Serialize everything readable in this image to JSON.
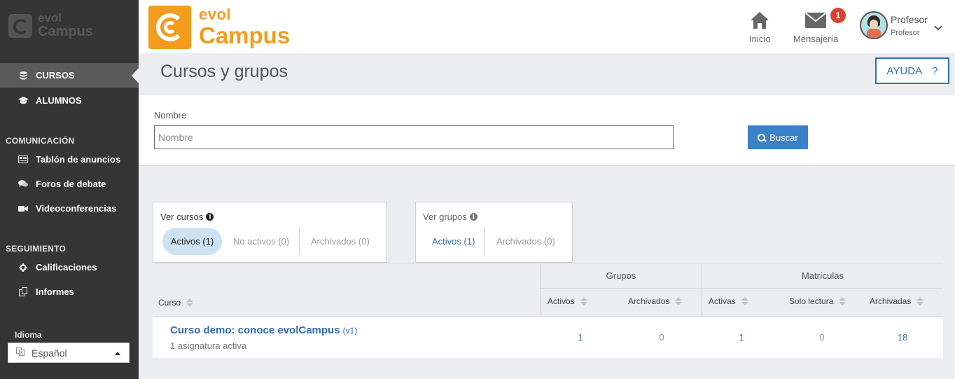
{
  "sidebar": {
    "logo": {
      "top": "evol",
      "bottom": "Campus"
    },
    "items": [
      {
        "label": "CURSOS",
        "icon": "database-icon"
      },
      {
        "label": "ALUMNOS",
        "icon": "graduation-cap-icon"
      }
    ],
    "sections": [
      {
        "title": "COMUNICACIÓN",
        "items": [
          {
            "label": "Tablón de anuncios",
            "icon": "newspaper-icon"
          },
          {
            "label": "Foros de debate",
            "icon": "comments-icon"
          },
          {
            "label": "Videoconferencias",
            "icon": "video-camera-icon"
          }
        ]
      },
      {
        "title": "SEGUIMIENTO",
        "items": [
          {
            "label": "Calificaciones",
            "icon": "gear-icon"
          },
          {
            "label": "Informes",
            "icon": "copy-icon"
          }
        ]
      }
    ],
    "language": {
      "label": "Idioma",
      "selected": "Español"
    }
  },
  "topbar": {
    "brand": {
      "top": "evol",
      "bottom": "Campus"
    },
    "home_label": "Inicio",
    "messages_label": "Mensajería",
    "messages_badge": "1",
    "user": {
      "name": "Profesor",
      "role": "Profesor"
    }
  },
  "page": {
    "title": "Cursos y grupos",
    "help_label": "AYUDA",
    "help_icon": "?"
  },
  "filter": {
    "name_label": "Nombre",
    "name_placeholder": "Nombre",
    "name_value": "",
    "search_label": "Buscar"
  },
  "view_courses": {
    "title": "Ver cursos",
    "tabs": [
      "Activos (1)",
      "No activos (0)",
      "Archivados (0)"
    ]
  },
  "view_groups": {
    "title": "Ver grupos",
    "tabs": [
      "Activos (1)",
      "Archivados (0)"
    ]
  },
  "table": {
    "group_headers": {
      "grupos": "Grupos",
      "matriculas": "Matrículas"
    },
    "columns": {
      "curso": "Curso",
      "grupos_activos": "Activos",
      "grupos_archivados": "Archivados",
      "mat_activas": "Activas",
      "mat_solo_lectura": "Solo lectura",
      "mat_archivadas": "Archivadas"
    },
    "rows": [
      {
        "title": "Curso demo: conoce evolCampus",
        "version": "(v1)",
        "subtitle": "1 asignatura activa",
        "grupos_activos": "1",
        "grupos_archivados": "0",
        "mat_activas": "1",
        "mat_solo_lectura": "0",
        "mat_archivadas": "18"
      }
    ]
  },
  "colors": {
    "sidebar_bg": "#353535",
    "brand_orange": "#f39c1d",
    "link_blue": "#2e6db4",
    "button_blue": "#3a82c8",
    "badge_red": "#d9432f"
  }
}
